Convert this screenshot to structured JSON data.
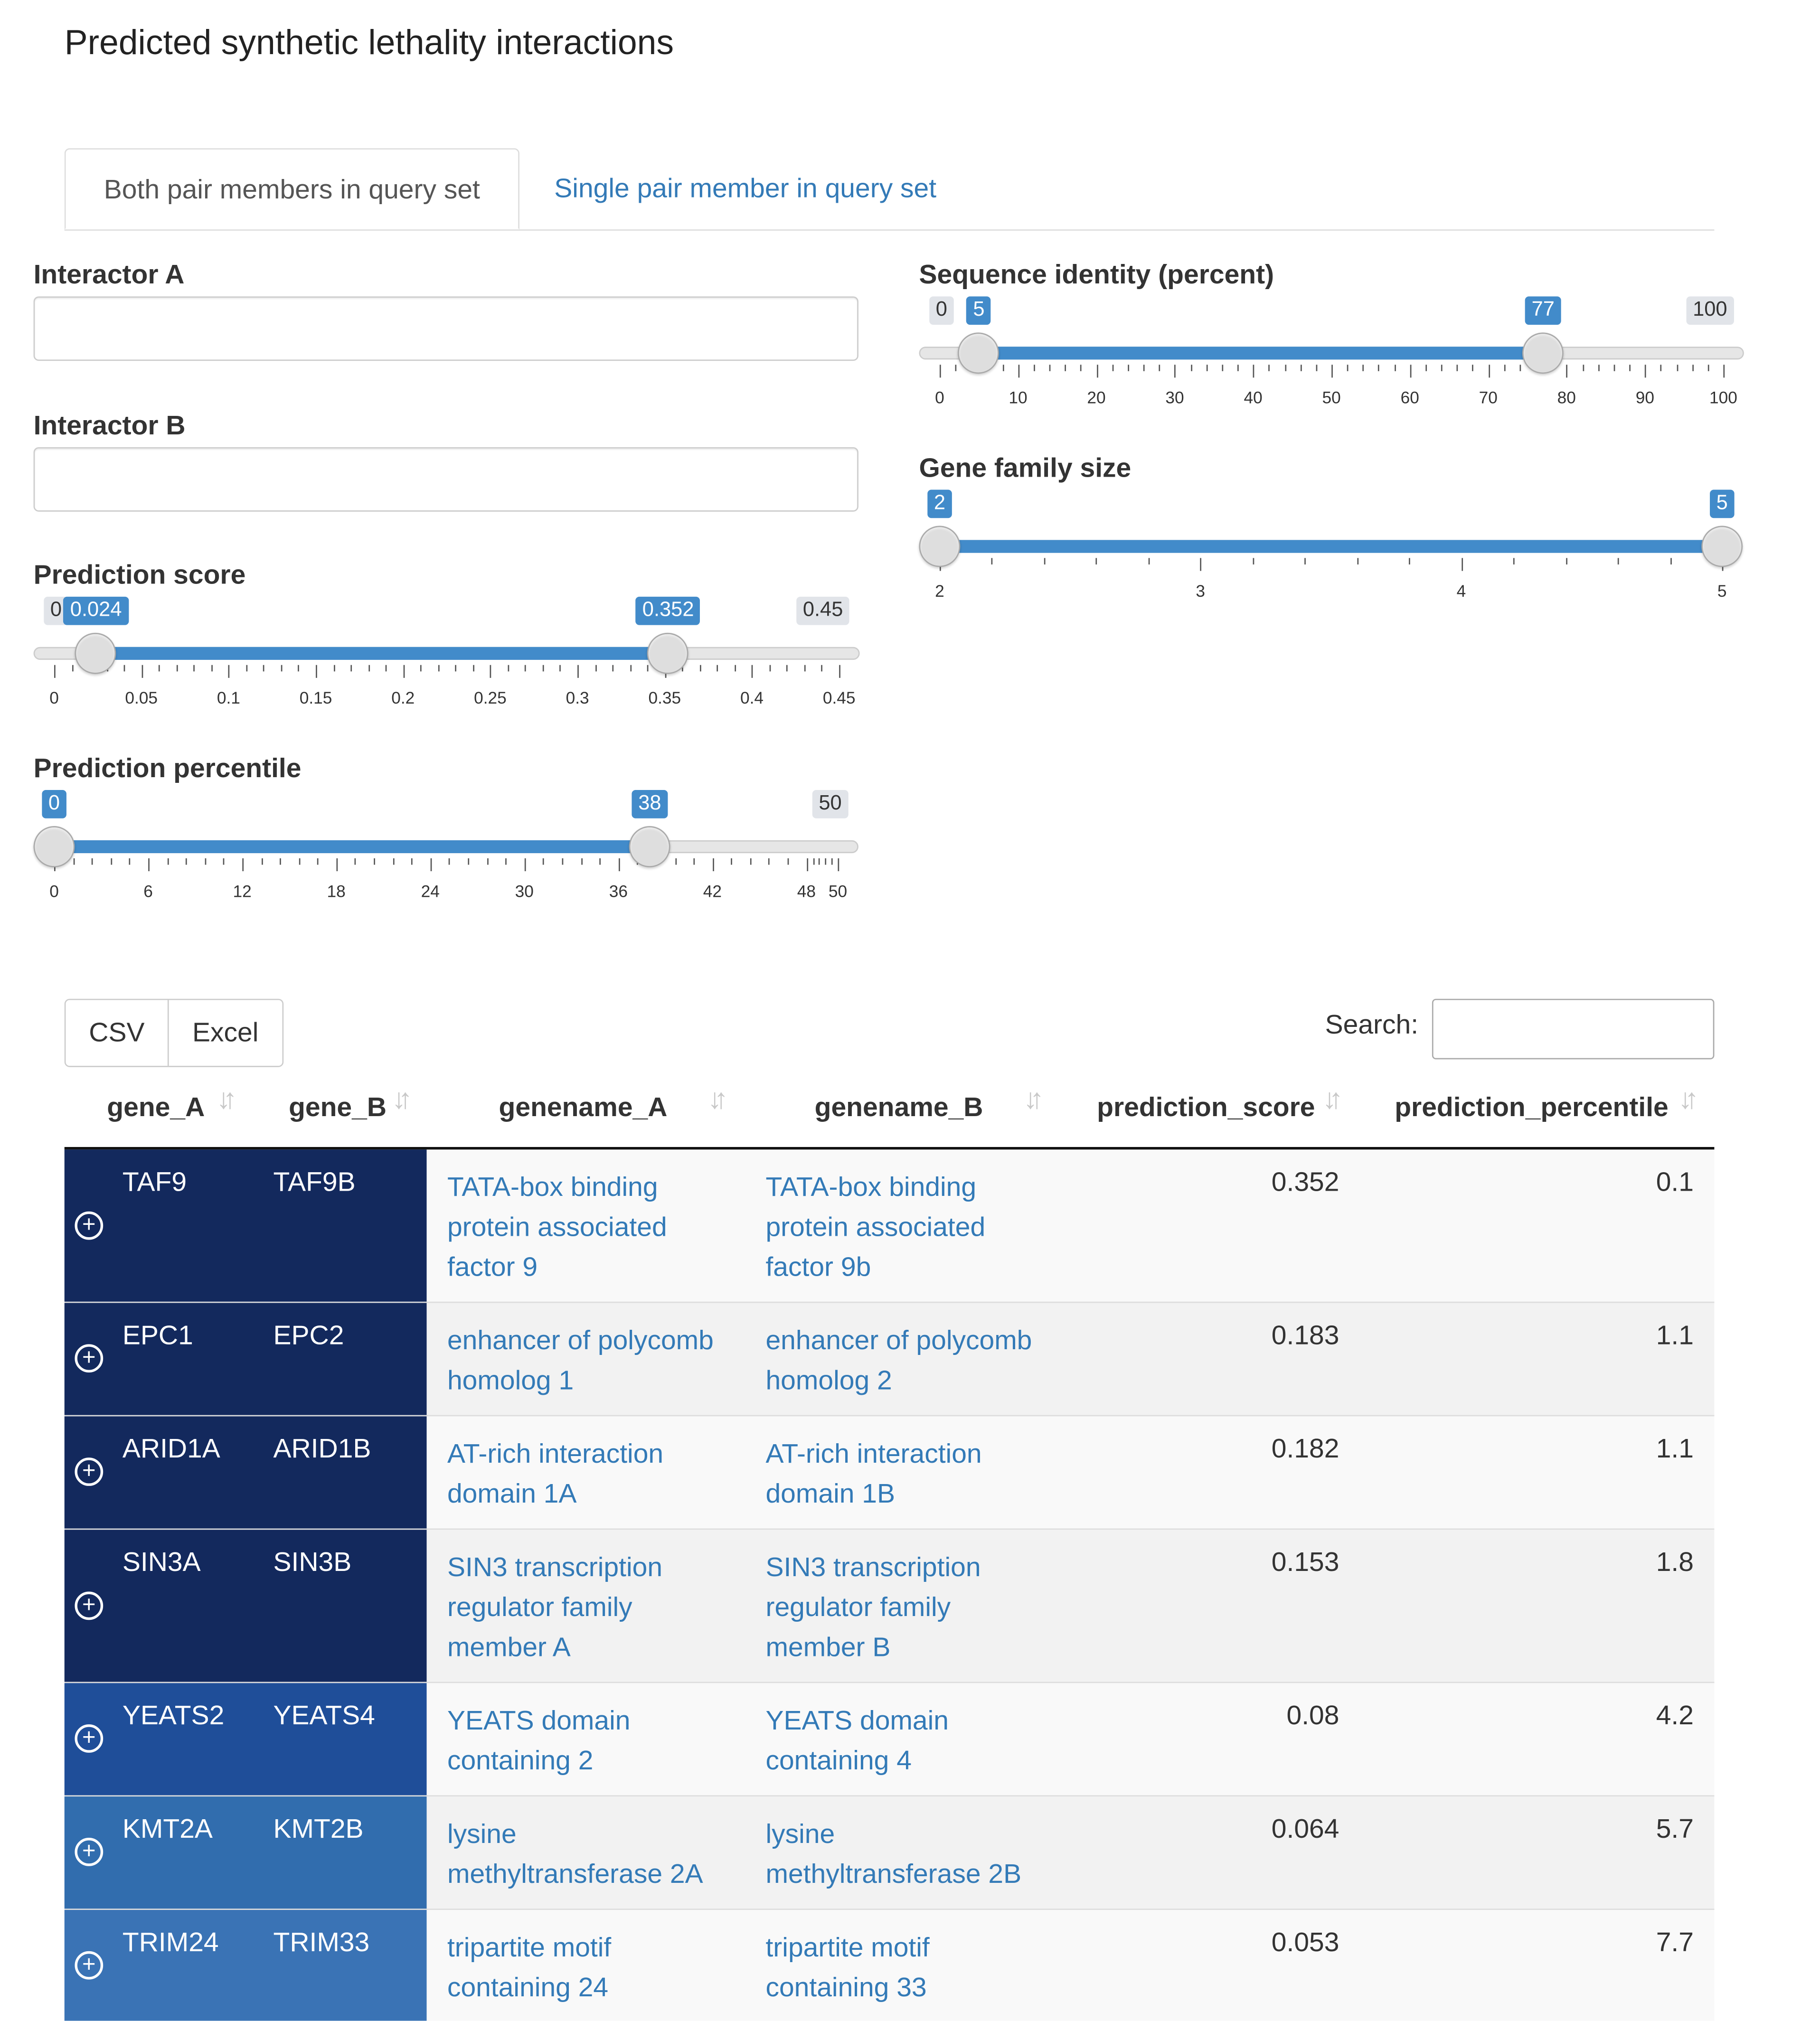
{
  "page_title": "Predicted synthetic lethality interactions",
  "tabs": [
    {
      "label": "Both pair members in query set",
      "active": true
    },
    {
      "label": "Single pair member in query set",
      "active": false
    }
  ],
  "filters": {
    "interactor_a": {
      "label": "Interactor A",
      "value": ""
    },
    "interactor_b": {
      "label": "Interactor B",
      "value": ""
    },
    "prediction_score": {
      "label": "Prediction score",
      "min": 0,
      "max": 0.45,
      "from": 0.024,
      "to": 0.352,
      "min_label": "0",
      "max_label": "0.45",
      "from_label": "0.024",
      "to_label": "0.352",
      "ticks": [
        "0",
        "0.05",
        "0.1",
        "0.15",
        "0.2",
        "0.25",
        "0.3",
        "0.35",
        "0.4",
        "0.45"
      ]
    },
    "prediction_percentile": {
      "label": "Prediction percentile",
      "min": 0,
      "max": 50,
      "from": 0,
      "to": 38,
      "min_label": "0",
      "max_label": "50",
      "from_label": "0",
      "to_label": "38",
      "ticks": [
        "0",
        "6",
        "12",
        "18",
        "24",
        "30",
        "36",
        "42",
        "48",
        "50"
      ]
    },
    "sequence_identity": {
      "label": "Sequence identity (percent)",
      "min": 0,
      "max": 100,
      "from": 5,
      "to": 77,
      "min_label": "0",
      "max_label": "100",
      "from_label": "5",
      "to_label": "77",
      "ticks": [
        "0",
        "10",
        "20",
        "30",
        "40",
        "50",
        "60",
        "70",
        "80",
        "90",
        "100"
      ]
    },
    "gene_family_size": {
      "label": "Gene family size",
      "min": 2,
      "max": 5,
      "from": 2,
      "to": 5,
      "min_label": "2",
      "max_label": "5",
      "from_label": "2",
      "to_label": "5",
      "ticks": [
        "2",
        "3",
        "4",
        "5"
      ]
    }
  },
  "export_buttons": {
    "csv": "CSV",
    "excel": "Excel"
  },
  "search": {
    "label": "Search:",
    "value": ""
  },
  "table": {
    "columns": [
      "gene_A",
      "gene_B",
      "genename_A",
      "genename_B",
      "prediction_score",
      "prediction_percentile"
    ],
    "rows": [
      {
        "gene_A": "TAF9",
        "gene_B": "TAF9B",
        "genename_A": "TATA-box binding protein associated factor 9",
        "genename_B": "TATA-box binding protein associated factor 9b",
        "prediction_score": "0.352",
        "prediction_percentile": "0.1",
        "color": "#13295d"
      },
      {
        "gene_A": "EPC1",
        "gene_B": "EPC2",
        "genename_A": "enhancer of polycomb homolog 1",
        "genename_B": "enhancer of polycomb homolog 2",
        "prediction_score": "0.183",
        "prediction_percentile": "1.1",
        "color": "#13295d"
      },
      {
        "gene_A": "ARID1A",
        "gene_B": "ARID1B",
        "genename_A": "AT-rich interaction domain 1A",
        "genename_B": "AT-rich interaction domain 1B",
        "prediction_score": "0.182",
        "prediction_percentile": "1.1",
        "color": "#13295d"
      },
      {
        "gene_A": "SIN3A",
        "gene_B": "SIN3B",
        "genename_A": "SIN3 transcription regulator family member A",
        "genename_B": "SIN3 transcription regulator family member B",
        "prediction_score": "0.153",
        "prediction_percentile": "1.8",
        "color": "#13295d"
      },
      {
        "gene_A": "YEATS2",
        "gene_B": "YEATS4",
        "genename_A": "YEATS domain containing 2",
        "genename_B": "YEATS domain containing 4",
        "prediction_score": "0.08",
        "prediction_percentile": "4.2",
        "color": "#1f4e99"
      },
      {
        "gene_A": "KMT2A",
        "gene_B": "KMT2B",
        "genename_A": "lysine methyltransferase 2A",
        "genename_B": "lysine methyltransferase 2B",
        "prediction_score": "0.064",
        "prediction_percentile": "5.7",
        "color": "#316dae"
      },
      {
        "gene_A": "TRIM24",
        "gene_B": "TRIM33",
        "genename_A": "tripartite motif containing 24",
        "genename_B": "tripartite motif containing 33",
        "prediction_score": "0.053",
        "prediction_percentile": "7.7",
        "color": "#3a73b5"
      }
    ]
  }
}
